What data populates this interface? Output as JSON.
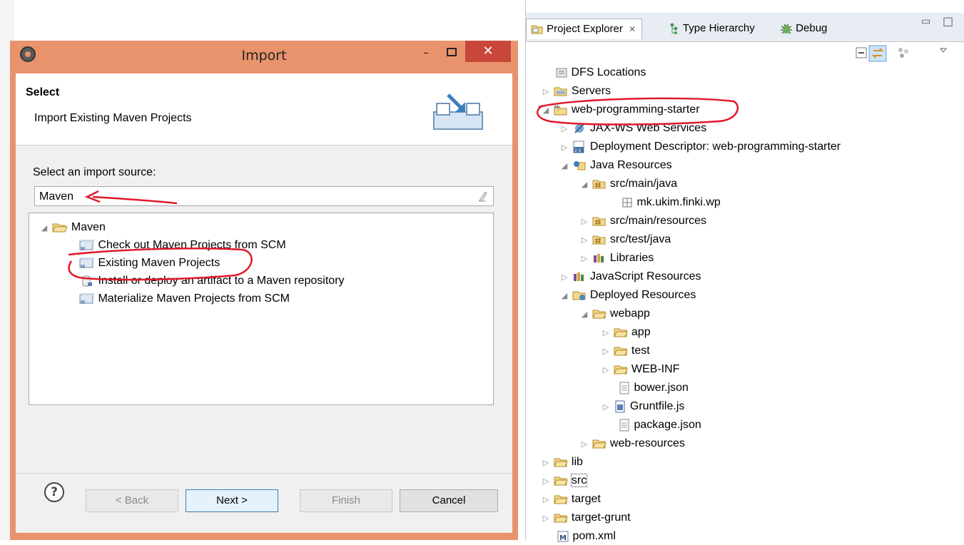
{
  "background_hint": "",
  "dialog": {
    "title": "Import",
    "header_title": "Select",
    "header_subtitle": "Import Existing Maven Projects",
    "source_label": "Select an import source:",
    "search_value": "Maven",
    "tree": {
      "root": "Maven",
      "items": [
        "Check out Maven Projects from SCM",
        "Existing Maven Projects",
        "Install or deploy an artifact to a Maven repository",
        "Materialize Maven Projects from SCM"
      ]
    },
    "buttons": {
      "back": "< Back",
      "next": "Next >",
      "finish": "Finish",
      "cancel": "Cancel"
    }
  },
  "explorer": {
    "tabs": [
      "Project Explorer",
      "Type Hierarchy",
      "Debug"
    ],
    "tree": [
      {
        "label": "DFS Locations"
      },
      {
        "label": "Servers"
      },
      {
        "label": "web-programming-starter"
      },
      {
        "label": "JAX-WS Web Services"
      },
      {
        "label": "Deployment Descriptor: web-programming-starter"
      },
      {
        "label": "Java Resources"
      },
      {
        "label": "src/main/java"
      },
      {
        "label": "mk.ukim.finki.wp"
      },
      {
        "label": "src/main/resources"
      },
      {
        "label": "src/test/java"
      },
      {
        "label": "Libraries"
      },
      {
        "label": "JavaScript Resources"
      },
      {
        "label": "Deployed Resources"
      },
      {
        "label": "webapp"
      },
      {
        "label": "app"
      },
      {
        "label": "test"
      },
      {
        "label": "WEB-INF"
      },
      {
        "label": "bower.json"
      },
      {
        "label": "Gruntfile.js"
      },
      {
        "label": "package.json"
      },
      {
        "label": "web-resources"
      },
      {
        "label": "lib"
      },
      {
        "label": "src"
      },
      {
        "label": "target"
      },
      {
        "label": "target-grunt"
      },
      {
        "label": "pom.xml"
      }
    ]
  },
  "colors": {
    "dialog_frame": "#e9936d",
    "close_button": "#c8473a",
    "annotation": "#e0192a",
    "folder": "#e8c35a"
  }
}
